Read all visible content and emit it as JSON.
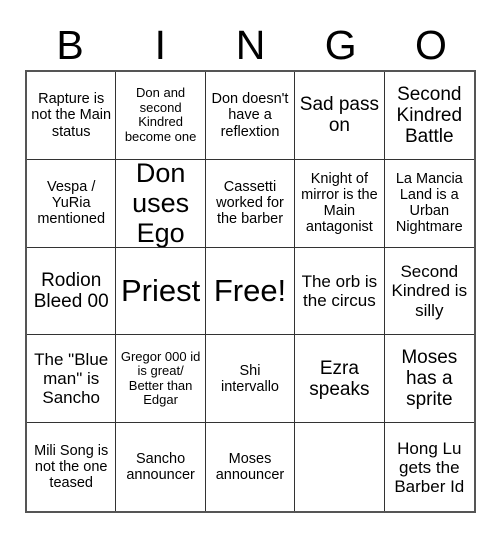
{
  "card": {
    "title": "BINGO",
    "header": {
      "letters": [
        "B",
        "I",
        "N",
        "G",
        "O"
      ]
    },
    "free_space_label": "Free!",
    "colors": {
      "text": "#000000",
      "grid_line": "#333333",
      "grid_border": "#555555",
      "background": "#ffffff"
    },
    "grid": {
      "rows": 5,
      "columns": 5,
      "cells": [
        {
          "text": "Rapture is not the Main status",
          "size": "sm",
          "free": false
        },
        {
          "text": "Don and second Kindred become one",
          "size": "xs",
          "free": false
        },
        {
          "text": "Don doesn't have a reflextion",
          "size": "sm",
          "free": false
        },
        {
          "text": "Sad pass on",
          "size": "lg",
          "free": false
        },
        {
          "text": "Second Kindred Battle",
          "size": "lg",
          "free": false
        },
        {
          "text": "Vespa / YuRia mentioned",
          "size": "sm",
          "free": false
        },
        {
          "text": "Don uses Ego",
          "size": "xl",
          "free": false
        },
        {
          "text": "Cassetti worked for the barber",
          "size": "sm",
          "free": false
        },
        {
          "text": "Knight of mirror is the Main antagonist",
          "size": "sm",
          "free": false
        },
        {
          "text": "La Mancia Land is a Urban Nightmare",
          "size": "sm",
          "free": false
        },
        {
          "text": "Rodion Bleed 00",
          "size": "lg",
          "free": false
        },
        {
          "text": "Priest",
          "size": "xxl",
          "free": false
        },
        {
          "text": "Free!",
          "size": "xxl",
          "free": true
        },
        {
          "text": "The orb is the circus",
          "size": "md",
          "free": false
        },
        {
          "text": "Second Kindred is silly",
          "size": "md",
          "free": false
        },
        {
          "text": "The \"Blue man\" is Sancho",
          "size": "md",
          "free": false
        },
        {
          "text": "Gregor 000 id is great/ Better than Edgar",
          "size": "xs",
          "free": false
        },
        {
          "text": "Shi intervallo",
          "size": "sm",
          "free": false
        },
        {
          "text": "Ezra speaks",
          "size": "lg",
          "free": false
        },
        {
          "text": "Moses has a sprite",
          "size": "lg",
          "free": false
        },
        {
          "text": "Mili Song is not the one teased",
          "size": "sm",
          "free": false
        },
        {
          "text": "Sancho announcer",
          "size": "sm",
          "free": false
        },
        {
          "text": "Moses announcer",
          "size": "sm",
          "free": false
        },
        {
          "text": "",
          "size": "sm",
          "free": false
        },
        {
          "text": "Hong Lu gets the Barber Id",
          "size": "md",
          "free": false
        }
      ]
    }
  }
}
